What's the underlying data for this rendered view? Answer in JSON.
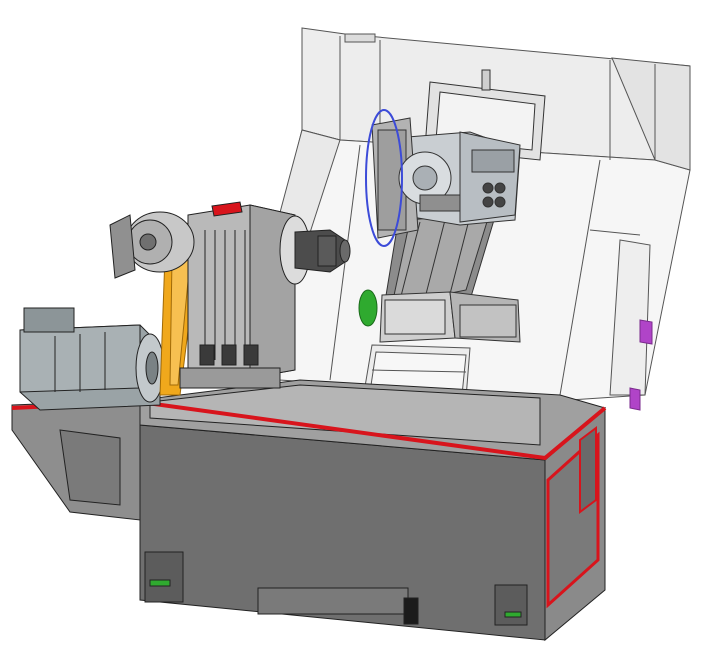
{
  "scene": {
    "background": "#ffffff",
    "colors": {
      "guard_panel": "#e6e6e6",
      "guard_face": "#f4f4f4",
      "guard_outline": "#555555",
      "base_dark": "#6f6f6f",
      "base_mid": "#8a8a8a",
      "base_light": "#a8a8a8",
      "accent_red": "#d8141c",
      "belt_orange": "#f0a81c",
      "motor_grey": "#9aa3a6",
      "headstock": "#b9b9b9",
      "turret_blue": "#3c4bd8",
      "turret_body": "#c9ced2",
      "green_part": "#2faa2f",
      "purple_part": "#b044c8",
      "slide_grey": "#7e7e7e",
      "carriage_light": "#d7d7d7"
    },
    "parts": [
      "cnc-lathe-base",
      "sheet-metal-guard",
      "spindle-motor",
      "drive-belt",
      "headstock",
      "spindle-nose",
      "turret",
      "cross-slide",
      "tailstock",
      "chip-tray"
    ]
  }
}
